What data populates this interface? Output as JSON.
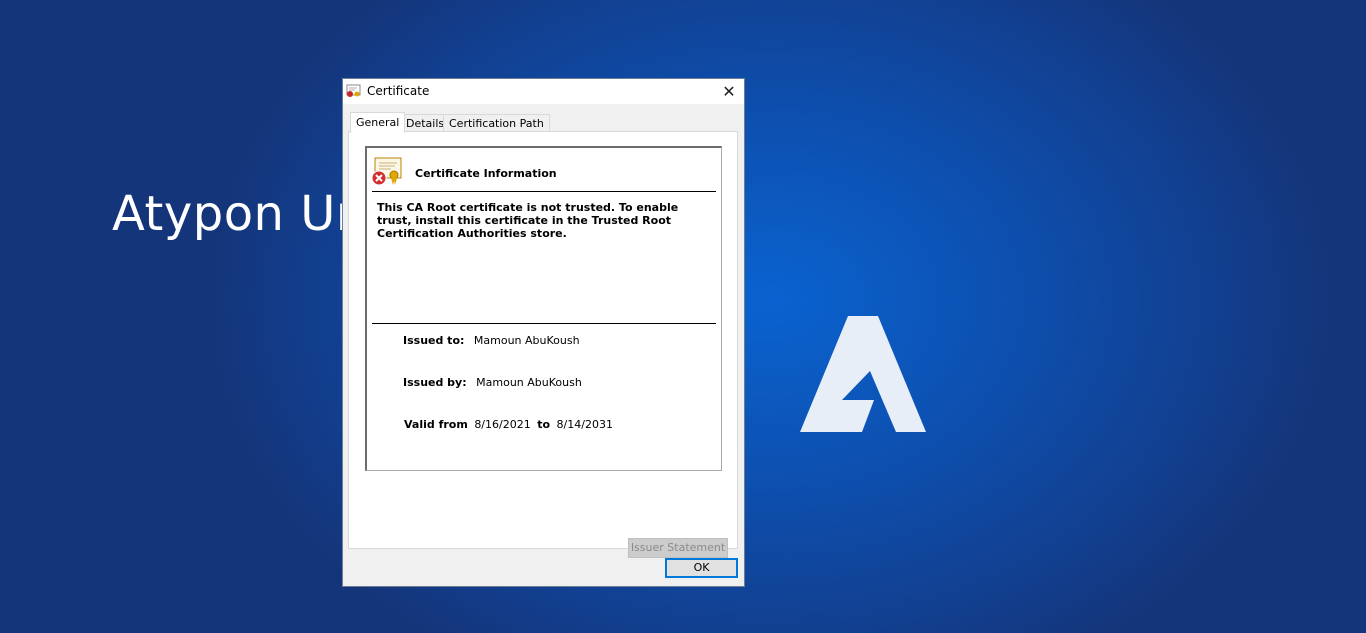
{
  "background": {
    "title": "Atypon Ur",
    "logo_icon": "atypon-a-logo"
  },
  "dialog": {
    "title": "Certificate",
    "title_icon": "certificate-icon",
    "close_glyph": "✕",
    "tabs": [
      {
        "label": "General",
        "active": true
      },
      {
        "label": "Details",
        "active": false
      },
      {
        "label": "Certification Path",
        "active": false
      }
    ],
    "info": {
      "icon": "certificate-error-icon",
      "heading": "Certificate Information",
      "message": "This CA Root certificate is not trusted. To enable trust, install this certificate in the Trusted Root Certification Authorities store.",
      "issued_to_label": "Issued to:",
      "issued_to": "Mamoun AbuKoush",
      "issued_by_label": "Issued by:",
      "issued_by": "Mamoun AbuKoush",
      "valid_from_label": "Valid from",
      "valid_from": "8/16/2021",
      "to_label": "to",
      "valid_to": "8/14/2031"
    },
    "issuer_statement_label": "Issuer Statement",
    "ok_label": "OK"
  },
  "colors": {
    "background": "#0d4fae",
    "focus_border": "#0078d7"
  }
}
